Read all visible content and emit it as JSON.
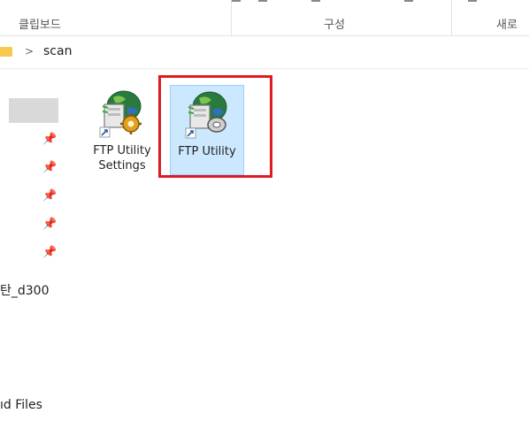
{
  "ribbon": {
    "clipboard_label": "클립보드",
    "organize_label": "구성",
    "new_label": "새로"
  },
  "address": {
    "folder_icon": "folder-icon",
    "separator": ">",
    "current": "scan"
  },
  "nav": {
    "pin_glyph": "📌",
    "items": [
      "탄_d300",
      "ıd Files"
    ]
  },
  "files": [
    {
      "name": "FTP Utility\nSettings",
      "icon": "ftp-utility-settings-icon",
      "selected": false
    },
    {
      "name": "FTP Utility",
      "icon": "ftp-utility-icon",
      "selected": true
    }
  ],
  "colors": {
    "selection_bg": "#cce8ff",
    "selection_border": "#99d1ff",
    "highlight": "#e01a22"
  }
}
